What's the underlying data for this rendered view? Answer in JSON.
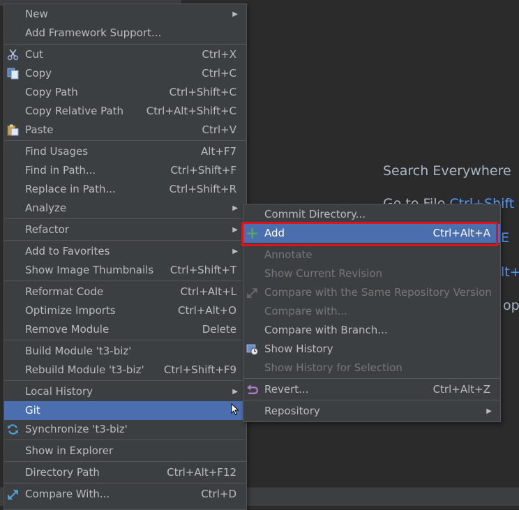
{
  "editor_hints": {
    "search_everywhere": "Search Everywhere",
    "goto_file": "Go to File",
    "goto_file_shortcut": "Ctrl+Shift",
    "partial_e": "E",
    "partial_alt": "lt+",
    "partial_op": "op"
  },
  "main_menu": {
    "new": "New",
    "add_framework": "Add Framework Support...",
    "cut": "Cut",
    "cut_sc": "Ctrl+X",
    "copy": "Copy",
    "copy_sc": "Ctrl+C",
    "copy_path": "Copy Path",
    "copy_path_sc": "Ctrl+Shift+C",
    "copy_relative_path": "Copy Relative Path",
    "copy_relative_path_sc": "Ctrl+Alt+Shift+C",
    "paste": "Paste",
    "paste_sc": "Ctrl+V",
    "find_usages": "Find Usages",
    "find_usages_sc": "Alt+F7",
    "find_in_path": "Find in Path...",
    "find_in_path_sc": "Ctrl+Shift+F",
    "replace_in_path": "Replace in Path...",
    "replace_in_path_sc": "Ctrl+Shift+R",
    "analyze": "Analyze",
    "refactor": "Refactor",
    "add_to_favorites": "Add to Favorites",
    "show_image_thumbnails": "Show Image Thumbnails",
    "show_image_thumbnails_sc": "Ctrl+Shift+T",
    "reformat_code": "Reformat Code",
    "reformat_code_sc": "Ctrl+Alt+L",
    "optimize_imports": "Optimize Imports",
    "optimize_imports_sc": "Ctrl+Alt+O",
    "remove_module": "Remove Module",
    "remove_module_sc": "Delete",
    "build_module": "Build Module 't3-biz'",
    "rebuild_module": "Rebuild Module 't3-biz'",
    "rebuild_module_sc": "Ctrl+Shift+F9",
    "local_history": "Local History",
    "git": "Git",
    "synchronize": "Synchronize 't3-biz'",
    "show_in_explorer": "Show in Explorer",
    "directory_path": "Directory Path",
    "directory_path_sc": "Ctrl+Alt+F12",
    "compare_with": "Compare With...",
    "compare_with_sc": "Ctrl+D"
  },
  "git_submenu": {
    "commit_directory": "Commit Directory...",
    "add": "Add",
    "add_sc": "Ctrl+Alt+A",
    "annotate": "Annotate",
    "show_current_revision": "Show Current Revision",
    "compare_same_repo": "Compare with the Same Repository Version",
    "compare_with": "Compare with...",
    "compare_with_branch": "Compare with Branch...",
    "show_history": "Show History",
    "show_history_selection": "Show History for Selection",
    "revert": "Revert...",
    "revert_sc": "Ctrl+Alt+Z",
    "repository": "Repository"
  },
  "colors": {
    "menu_bg": "#3c3f41",
    "selection": "#4b6eaf",
    "highlight_box": "#e0121b",
    "shortcut_link": "#589df6"
  }
}
